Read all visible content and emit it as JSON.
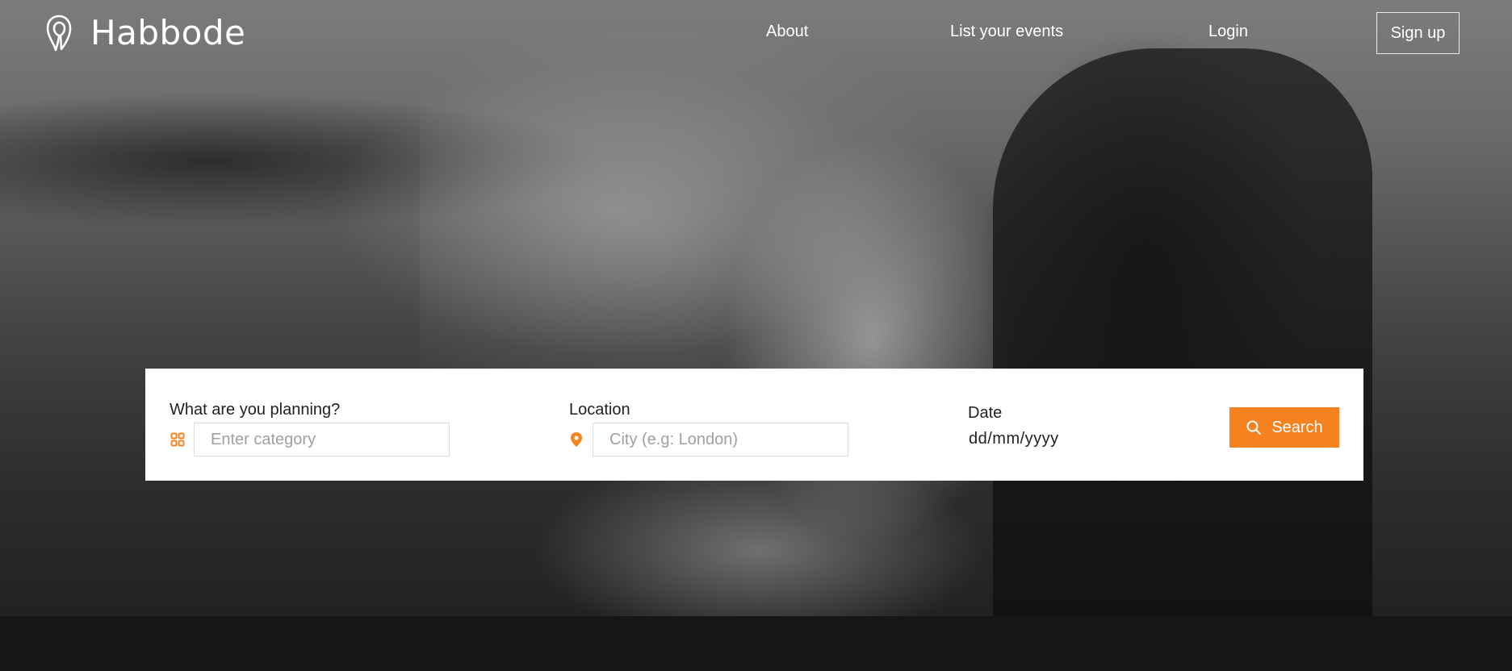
{
  "brand": {
    "name": "Habbode",
    "logo_icon": "location-pin-outline-icon"
  },
  "nav": {
    "about": "About",
    "list_events": "List your events",
    "login": "Login",
    "signup": "Sign up"
  },
  "search": {
    "planning": {
      "label": "What are you planning?",
      "placeholder": "Enter category",
      "value": "",
      "icon": "category-grid-icon"
    },
    "location": {
      "label": "Location",
      "placeholder": "City (e.g: London)",
      "value": "",
      "icon": "map-pin-icon"
    },
    "date": {
      "label": "Date",
      "value": "dd/mm/yyyy"
    },
    "button": {
      "label": "Search",
      "icon": "search-icon"
    }
  },
  "colors": {
    "accent": "#f5821f",
    "panel": "#ffffff",
    "footer": "#161616",
    "nav_text": "#ffffff"
  }
}
